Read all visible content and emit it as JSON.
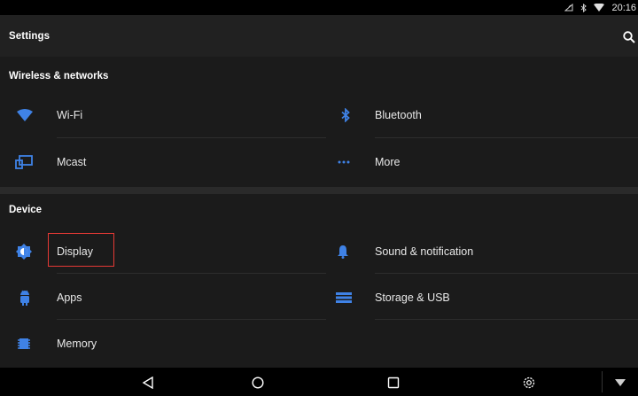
{
  "status_bar": {
    "time": "20:16",
    "icons": [
      "signal-icon",
      "bluetooth-status-icon",
      "wifi-status-icon"
    ]
  },
  "app_bar": {
    "title": "Settings",
    "search_icon": "search-icon"
  },
  "sections": {
    "wireless": {
      "header": "Wireless & networks",
      "items": [
        {
          "label": "Wi-Fi",
          "icon": "wifi-icon"
        },
        {
          "label": "Bluetooth",
          "icon": "bluetooth-icon"
        },
        {
          "label": "Mcast",
          "icon": "cast-icon"
        },
        {
          "label": "More",
          "icon": "more-icon"
        }
      ]
    },
    "device": {
      "header": "Device",
      "items": [
        {
          "label": "Display",
          "icon": "brightness-icon"
        },
        {
          "label": "Sound & notification",
          "icon": "bell-icon"
        },
        {
          "label": "Apps",
          "icon": "android-icon"
        },
        {
          "label": "Storage & USB",
          "icon": "storage-icon"
        },
        {
          "label": "Memory",
          "icon": "memory-icon"
        }
      ]
    }
  },
  "nav_bar": {
    "buttons": [
      "back-icon",
      "home-icon",
      "recents-icon",
      "settings-gear-icon",
      "dropdown-triangle-icon"
    ]
  },
  "colors": {
    "accent": "#3f82e6",
    "status_bar_bg": "#000000",
    "app_bar_bg": "#212121",
    "content_bg": "#1b1b1b",
    "highlight_border": "#e53935"
  }
}
